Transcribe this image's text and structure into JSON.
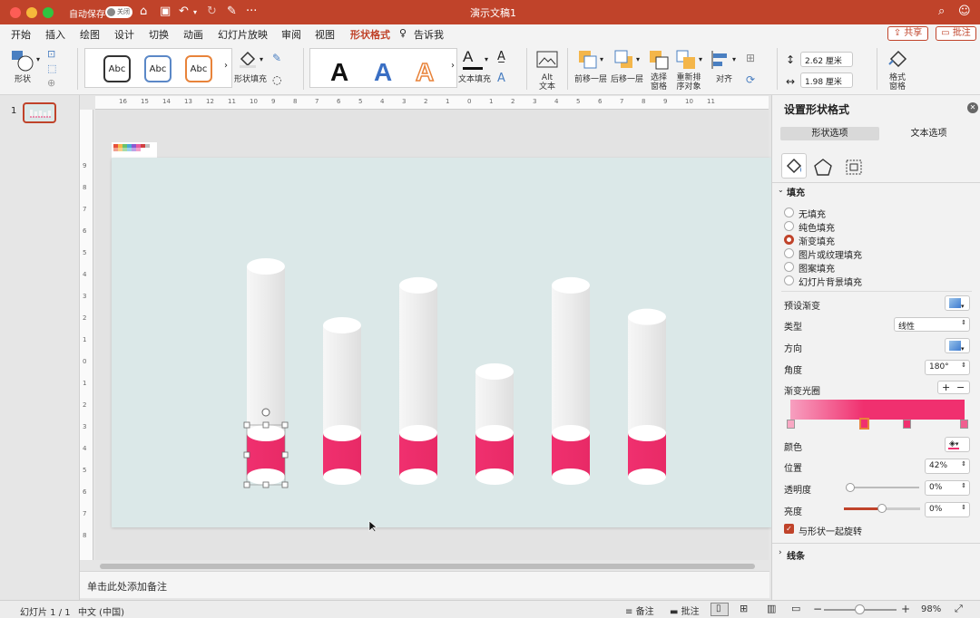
{
  "titlebar": {
    "autosave_label": "自动保存",
    "autosave_state": "关闭",
    "document_title": "演示文稿1",
    "more": "···"
  },
  "menu_tabs": [
    "开始",
    "插入",
    "绘图",
    "设计",
    "切换",
    "动画",
    "幻灯片放映",
    "审阅",
    "视图",
    "形状格式",
    "告诉我"
  ],
  "menu_active": "形状格式",
  "menu_actions": {
    "share": "共享",
    "comments": "批注"
  },
  "ribbon": {
    "shape_label": "形状",
    "style_samples": [
      "Abc",
      "Abc",
      "Abc"
    ],
    "shape_fill_label": "形状填充",
    "wordart_samples": [
      "A",
      "A",
      "A"
    ],
    "text_fill_label": "文本填充",
    "alt_text_label": "Alt\n文本",
    "bring_forward": "前移一层",
    "send_backward": "后移一层",
    "selection_pane": "选择\n窗格",
    "reorder_objects": "重新排\n序对象",
    "align": "对齐",
    "height_value": "2.62 厘米",
    "width_value": "1.98 厘米",
    "format_pane": "格式\n窗格"
  },
  "thumbnails": {
    "slide_number": "1"
  },
  "ruler_numbers": [
    "16",
    "15",
    "14",
    "13",
    "12",
    "11",
    "10",
    "9",
    "8",
    "7",
    "6",
    "5",
    "4",
    "3",
    "2",
    "1",
    "0",
    "1",
    "2",
    "3",
    "4",
    "5",
    "6",
    "7",
    "8",
    "9",
    "10",
    "11"
  ],
  "vruler_numbers": [
    "9",
    "8",
    "7",
    "6",
    "5",
    "4",
    "3",
    "2",
    "1",
    "0",
    "1",
    "2",
    "3",
    "4",
    "5",
    "6",
    "7",
    "8"
  ],
  "slide": {
    "bars": [
      {
        "fill": 0.42,
        "height": 1.0
      },
      {
        "fill": 0.42,
        "height": 0.72
      },
      {
        "fill": 0.42,
        "height": 0.91
      },
      {
        "fill": 0.42,
        "height": 0.5
      },
      {
        "fill": 0.42,
        "height": 0.91
      },
      {
        "fill": 0.42,
        "height": 0.76
      }
    ],
    "colors": {
      "cylinder": "#f0f0f0",
      "fill": "#f0306f",
      "background": "#dbe8e8"
    }
  },
  "notes_placeholder": "单击此处添加备注",
  "status": {
    "slide_counter": "幻灯片 1 / 1",
    "language": "中文 (中国)",
    "notes_btn": "备注",
    "comments_btn": "批注",
    "zoom": "98%",
    "minus": "−",
    "plus": "+"
  },
  "pane": {
    "title": "设置形状格式",
    "tab_shape": "形状选项",
    "tab_text": "文本选项",
    "fill_header": "填充",
    "fill_options": [
      "无填充",
      "纯色填充",
      "渐变填充",
      "图片或纹理填充",
      "图案填充",
      "幻灯片背景填充"
    ],
    "fill_selected_index": 2,
    "preset_gradient": "预设渐变",
    "type_label": "类型",
    "type_value": "线性",
    "direction_label": "方向",
    "angle_label": "角度",
    "angle_value": "180°",
    "gradient_stops_label": "渐变光圈",
    "color_label": "颜色",
    "position_label": "位置",
    "position_value": "42%",
    "transparency_label": "透明度",
    "transparency_value": "0%",
    "brightness_label": "亮度",
    "brightness_value": "0%",
    "rotate_with_shape": "与形状一起旋转",
    "line_header": "线条",
    "accent": "#c0432a",
    "gradient_color": "#f0306f"
  }
}
